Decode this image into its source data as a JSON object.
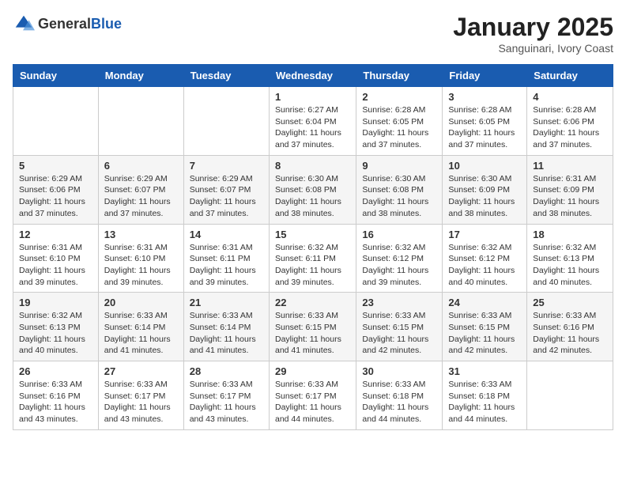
{
  "header": {
    "logo_general": "General",
    "logo_blue": "Blue",
    "month": "January 2025",
    "location": "Sanguinari, Ivory Coast"
  },
  "weekdays": [
    "Sunday",
    "Monday",
    "Tuesday",
    "Wednesday",
    "Thursday",
    "Friday",
    "Saturday"
  ],
  "weeks": [
    [
      {
        "day": "",
        "info": ""
      },
      {
        "day": "",
        "info": ""
      },
      {
        "day": "",
        "info": ""
      },
      {
        "day": "1",
        "info": "Sunrise: 6:27 AM\nSunset: 6:04 PM\nDaylight: 11 hours\nand 37 minutes."
      },
      {
        "day": "2",
        "info": "Sunrise: 6:28 AM\nSunset: 6:05 PM\nDaylight: 11 hours\nand 37 minutes."
      },
      {
        "day": "3",
        "info": "Sunrise: 6:28 AM\nSunset: 6:05 PM\nDaylight: 11 hours\nand 37 minutes."
      },
      {
        "day": "4",
        "info": "Sunrise: 6:28 AM\nSunset: 6:06 PM\nDaylight: 11 hours\nand 37 minutes."
      }
    ],
    [
      {
        "day": "5",
        "info": "Sunrise: 6:29 AM\nSunset: 6:06 PM\nDaylight: 11 hours\nand 37 minutes."
      },
      {
        "day": "6",
        "info": "Sunrise: 6:29 AM\nSunset: 6:07 PM\nDaylight: 11 hours\nand 37 minutes."
      },
      {
        "day": "7",
        "info": "Sunrise: 6:29 AM\nSunset: 6:07 PM\nDaylight: 11 hours\nand 37 minutes."
      },
      {
        "day": "8",
        "info": "Sunrise: 6:30 AM\nSunset: 6:08 PM\nDaylight: 11 hours\nand 38 minutes."
      },
      {
        "day": "9",
        "info": "Sunrise: 6:30 AM\nSunset: 6:08 PM\nDaylight: 11 hours\nand 38 minutes."
      },
      {
        "day": "10",
        "info": "Sunrise: 6:30 AM\nSunset: 6:09 PM\nDaylight: 11 hours\nand 38 minutes."
      },
      {
        "day": "11",
        "info": "Sunrise: 6:31 AM\nSunset: 6:09 PM\nDaylight: 11 hours\nand 38 minutes."
      }
    ],
    [
      {
        "day": "12",
        "info": "Sunrise: 6:31 AM\nSunset: 6:10 PM\nDaylight: 11 hours\nand 39 minutes."
      },
      {
        "day": "13",
        "info": "Sunrise: 6:31 AM\nSunset: 6:10 PM\nDaylight: 11 hours\nand 39 minutes."
      },
      {
        "day": "14",
        "info": "Sunrise: 6:31 AM\nSunset: 6:11 PM\nDaylight: 11 hours\nand 39 minutes."
      },
      {
        "day": "15",
        "info": "Sunrise: 6:32 AM\nSunset: 6:11 PM\nDaylight: 11 hours\nand 39 minutes."
      },
      {
        "day": "16",
        "info": "Sunrise: 6:32 AM\nSunset: 6:12 PM\nDaylight: 11 hours\nand 39 minutes."
      },
      {
        "day": "17",
        "info": "Sunrise: 6:32 AM\nSunset: 6:12 PM\nDaylight: 11 hours\nand 40 minutes."
      },
      {
        "day": "18",
        "info": "Sunrise: 6:32 AM\nSunset: 6:13 PM\nDaylight: 11 hours\nand 40 minutes."
      }
    ],
    [
      {
        "day": "19",
        "info": "Sunrise: 6:32 AM\nSunset: 6:13 PM\nDaylight: 11 hours\nand 40 minutes."
      },
      {
        "day": "20",
        "info": "Sunrise: 6:33 AM\nSunset: 6:14 PM\nDaylight: 11 hours\nand 41 minutes."
      },
      {
        "day": "21",
        "info": "Sunrise: 6:33 AM\nSunset: 6:14 PM\nDaylight: 11 hours\nand 41 minutes."
      },
      {
        "day": "22",
        "info": "Sunrise: 6:33 AM\nSunset: 6:15 PM\nDaylight: 11 hours\nand 41 minutes."
      },
      {
        "day": "23",
        "info": "Sunrise: 6:33 AM\nSunset: 6:15 PM\nDaylight: 11 hours\nand 42 minutes."
      },
      {
        "day": "24",
        "info": "Sunrise: 6:33 AM\nSunset: 6:15 PM\nDaylight: 11 hours\nand 42 minutes."
      },
      {
        "day": "25",
        "info": "Sunrise: 6:33 AM\nSunset: 6:16 PM\nDaylight: 11 hours\nand 42 minutes."
      }
    ],
    [
      {
        "day": "26",
        "info": "Sunrise: 6:33 AM\nSunset: 6:16 PM\nDaylight: 11 hours\nand 43 minutes."
      },
      {
        "day": "27",
        "info": "Sunrise: 6:33 AM\nSunset: 6:17 PM\nDaylight: 11 hours\nand 43 minutes."
      },
      {
        "day": "28",
        "info": "Sunrise: 6:33 AM\nSunset: 6:17 PM\nDaylight: 11 hours\nand 43 minutes."
      },
      {
        "day": "29",
        "info": "Sunrise: 6:33 AM\nSunset: 6:17 PM\nDaylight: 11 hours\nand 44 minutes."
      },
      {
        "day": "30",
        "info": "Sunrise: 6:33 AM\nSunset: 6:18 PM\nDaylight: 11 hours\nand 44 minutes."
      },
      {
        "day": "31",
        "info": "Sunrise: 6:33 AM\nSunset: 6:18 PM\nDaylight: 11 hours\nand 44 minutes."
      },
      {
        "day": "",
        "info": ""
      }
    ]
  ]
}
